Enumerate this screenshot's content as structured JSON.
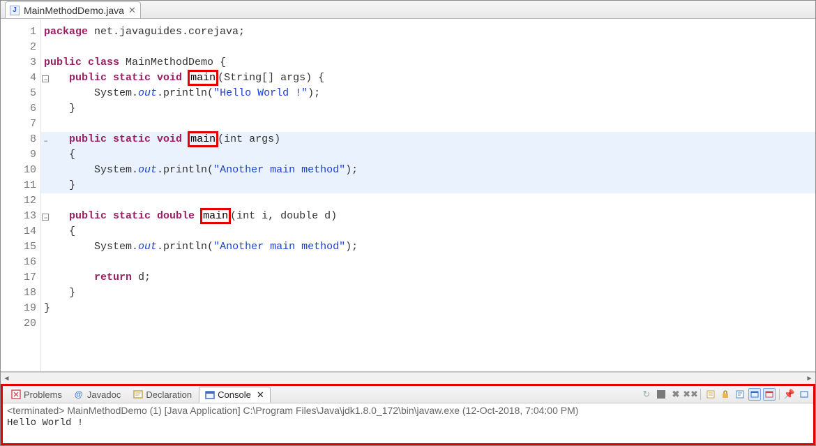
{
  "editor": {
    "tab": {
      "filename": "MainMethodDemo.java",
      "icon_letter": "J"
    },
    "line_numbers": [
      "1",
      "2",
      "3",
      "4",
      "5",
      "6",
      "7",
      "8",
      "9",
      "10",
      "11",
      "12",
      "13",
      "14",
      "15",
      "16",
      "17",
      "18",
      "19",
      "20"
    ],
    "fold_lines": [
      4,
      8,
      13
    ],
    "highlight_lines": [
      8,
      9,
      10,
      11
    ],
    "code": {
      "package_kw": "package",
      "package_name": " net.javaguides.corejava;",
      "class_decl_kw": "public class",
      "class_name": " MainMethodDemo ",
      "brace_open": "{",
      "m1_mods": "public static void",
      "m1_name": "main",
      "m1_params": "(String[] args) {",
      "m1_body_prefix": "System.",
      "m1_body_out": "out",
      "m1_body_call": ".println(",
      "m1_body_str": "\"Hello World !\"",
      "m1_body_suffix": ");",
      "brace_close": "}",
      "m2_mods": "public static void",
      "m2_name": "main",
      "m2_params": "(int args)",
      "m2_open": "{",
      "m2_body_prefix": "System.",
      "m2_body_out": "out",
      "m2_body_call": ".println(",
      "m2_body_str": "\"Another main method\"",
      "m2_body_suffix": ");",
      "m2_close": "}",
      "m3_mods": "public static double",
      "m3_name": "main",
      "m3_params": "(int i, double d)",
      "m3_open": "{",
      "m3_body_prefix": "System.",
      "m3_body_out": "out",
      "m3_body_call": ".println(",
      "m3_body_str": "\"Another main method\"",
      "m3_body_suffix": ");",
      "m3_ret_kw": "return",
      "m3_ret_val": " d;",
      "m3_close": "}",
      "class_close": "}"
    }
  },
  "views": {
    "problems": "Problems",
    "javadoc": "Javadoc",
    "declaration": "Declaration",
    "console": "Console"
  },
  "console": {
    "header": "<terminated> MainMethodDemo (1) [Java Application] C:\\Program Files\\Java\\jdk1.8.0_172\\bin\\javaw.exe (12-Oct-2018, 7:04:00 PM)",
    "output": "Hello World !"
  }
}
